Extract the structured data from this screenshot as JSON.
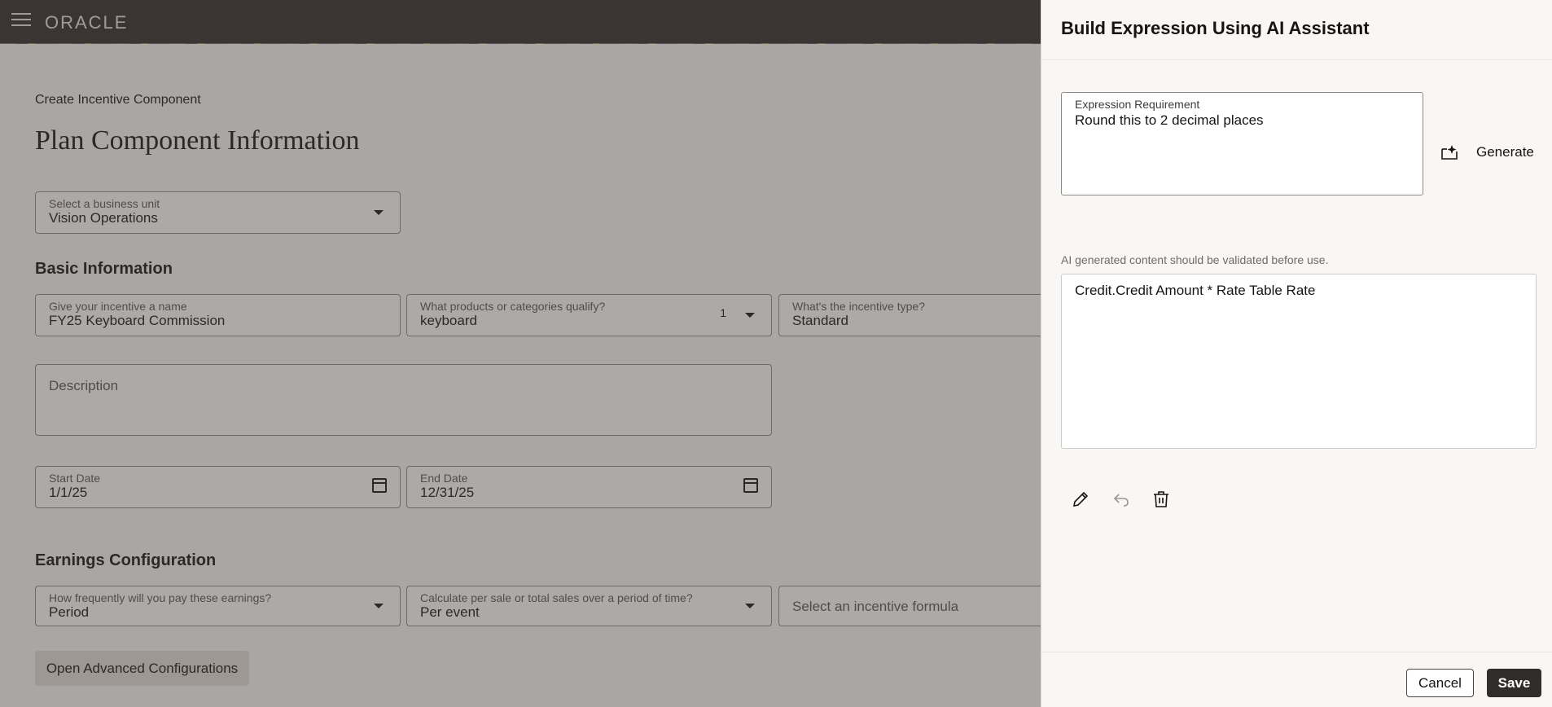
{
  "header": {
    "brand": "ORACLE",
    "menu_icon": "hamburger-icon"
  },
  "page": {
    "breadcrumb": "Create Incentive Component",
    "title": "Plan Component Information",
    "business_unit": {
      "label": "Select a business unit",
      "value": "Vision Operations"
    }
  },
  "basic_info": {
    "heading": "Basic Information",
    "name": {
      "label": "Give your incentive a name",
      "value": "FY25 Keyboard Commission"
    },
    "products": {
      "label": "What products or categories qualify?",
      "value": "keyboard",
      "count": "1"
    },
    "type": {
      "label": "What's the incentive type?",
      "value": "Standard"
    },
    "description": {
      "placeholder": "Description"
    },
    "start_date": {
      "label": "Start Date",
      "value": "1/1/25"
    },
    "end_date": {
      "label": "End Date",
      "value": "12/31/25"
    }
  },
  "earnings": {
    "heading": "Earnings Configuration",
    "frequency": {
      "label": "How frequently will you pay these earnings?",
      "value": "Period"
    },
    "calculation": {
      "label": "Calculate per sale or total sales over a period of time?",
      "value": "Per event"
    },
    "formula": {
      "placeholder": "Select an incentive formula"
    },
    "advanced_button": "Open Advanced Configurations"
  },
  "drawer": {
    "title": "Build Expression Using AI Assistant",
    "requirement": {
      "label": "Expression Requirement",
      "value": "Round this to 2 decimal places"
    },
    "generate_label": "Generate",
    "notice": "AI generated content should be validated before use.",
    "result": "Credit.Credit Amount * Rate Table Rate",
    "tools": [
      "edit-icon",
      "undo-icon",
      "delete-icon"
    ],
    "cancel_label": "Cancel",
    "save_label": "Save"
  }
}
